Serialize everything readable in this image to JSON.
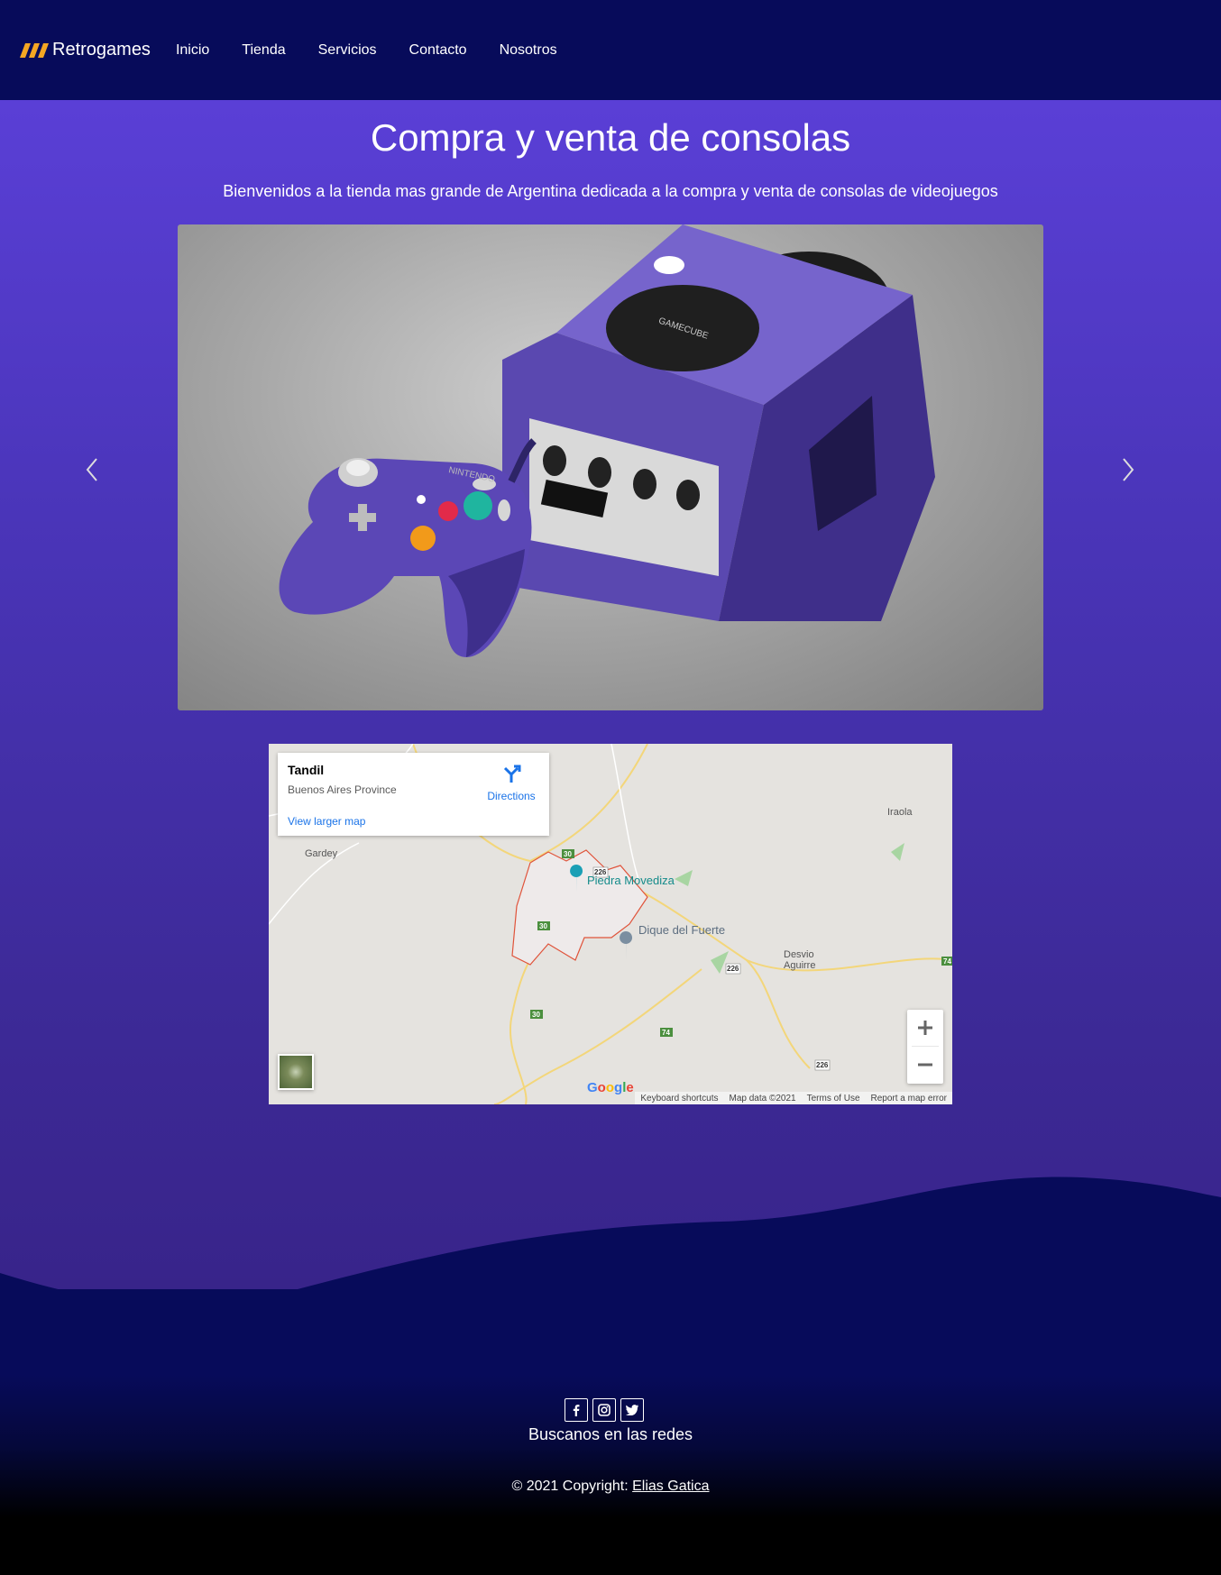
{
  "navbar": {
    "brand": "Retrogames",
    "links": [
      "Inicio",
      "Tienda",
      "Servicios",
      "Contacto",
      "Nosotros"
    ]
  },
  "hero": {
    "title": "Compra y venta de consolas",
    "subtitle": "Bienvenidos a la tienda mas grande de Argentina dedicada a la compra y venta de consolas de videojuegos"
  },
  "carousel": {
    "console_label": "GAMECUBE",
    "brand_label": "NINTENDO"
  },
  "map": {
    "place": "Tandil",
    "region": "Buenos Aires Province",
    "directions": "Directions",
    "view_larger": "View larger map",
    "labels": {
      "iraola": "Iraola",
      "gardey": "Gardey",
      "desvio1": "Desvio",
      "desvio2": "Aguirre",
      "piedra": "Piedra Movediza",
      "dique": "Dique del Fuerte"
    },
    "road_badges": [
      "30",
      "226",
      "30",
      "226",
      "30",
      "74",
      "226",
      "74"
    ],
    "footer": [
      "Keyboard shortcuts",
      "Map data ©2021",
      "Terms of Use",
      "Report a map error"
    ],
    "google": "Google"
  },
  "footer": {
    "social_text": "Buscanos en las redes",
    "copyright_prefix": "© 2021 Copyright: ",
    "author": "Elias Gatica"
  },
  "colors": {
    "nav_bg": "#070b5a",
    "accent": "#f5a623",
    "hero_top": "#5a3fd6",
    "hero_bottom": "#38248a"
  }
}
